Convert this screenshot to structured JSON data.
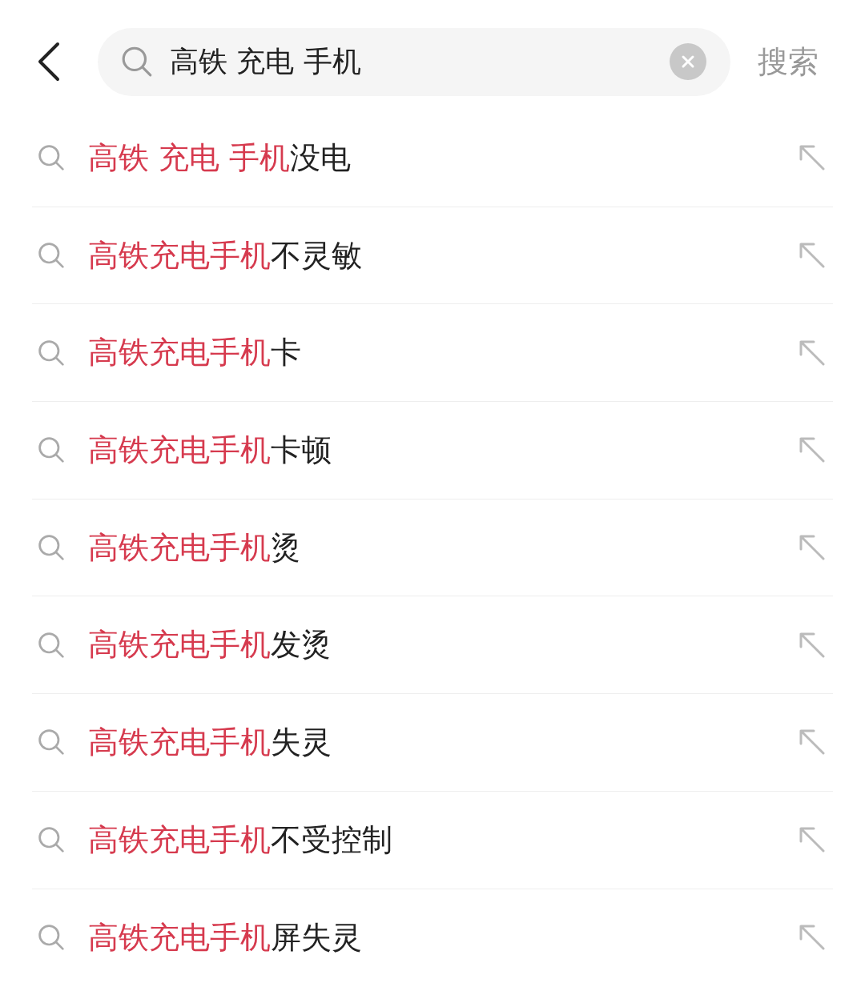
{
  "search": {
    "value": "高铁 充电 手机",
    "submit": "搜索"
  },
  "suggestions": [
    {
      "match": "高铁 充电 手机",
      "rest": "没电"
    },
    {
      "match": "高铁充电手机",
      "rest": "不灵敏"
    },
    {
      "match": "高铁充电手机",
      "rest": "卡"
    },
    {
      "match": "高铁充电手机",
      "rest": "卡顿"
    },
    {
      "match": "高铁充电手机",
      "rest": "烫"
    },
    {
      "match": "高铁充电手机",
      "rest": "发烫"
    },
    {
      "match": "高铁充电手机",
      "rest": "失灵"
    },
    {
      "match": "高铁充电手机",
      "rest": "不受控制"
    },
    {
      "match": "高铁充电手机",
      "rest": "屏失灵"
    }
  ]
}
